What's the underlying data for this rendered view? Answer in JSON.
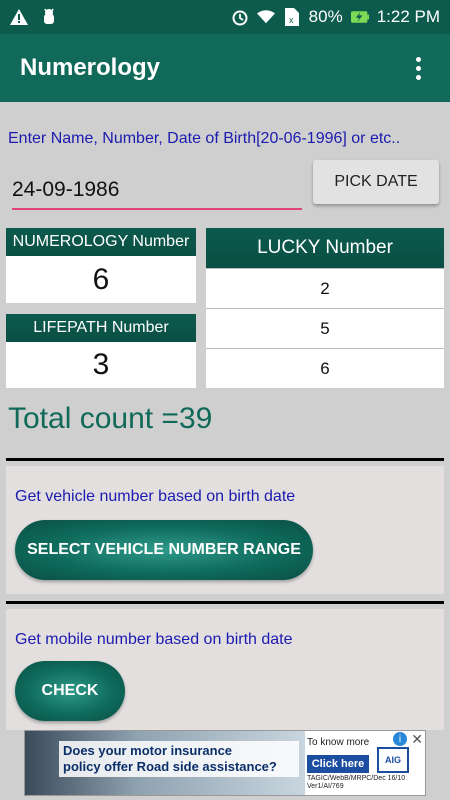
{
  "status_bar": {
    "battery": "80%",
    "time": "1:22 PM",
    "icons": [
      "warning-icon",
      "android-debug-icon",
      "alarm-icon",
      "wifi-icon",
      "sim-no-data-icon",
      "battery-charging-icon"
    ]
  },
  "app_bar": {
    "title": "Numerology",
    "menu_icon": "overflow-menu-icon"
  },
  "input": {
    "hint_label": "Enter Name, Number, Date of Birth[20-06-1996] or etc..",
    "value": "24-09-1986",
    "pick_date_label": "PICK DATE"
  },
  "numerology": {
    "label": "NUMEROLOGY Number",
    "value": "6"
  },
  "lifepath": {
    "label": "LIFEPATH Number",
    "value": "3"
  },
  "lucky": {
    "label": "LUCKY Number",
    "values": [
      "2",
      "5",
      "6"
    ]
  },
  "total": "Total count =39",
  "vehicle": {
    "text": "Get vehicle number based on birth date",
    "button_label": "SELECT VEHICLE NUMBER RANGE"
  },
  "mobile": {
    "text": "Get mobile number based on birth date",
    "button_label": "CHECK"
  },
  "ad": {
    "copy_line1": "Does your motor insurance",
    "copy_line2": "policy offer Road side assistance?",
    "to_know_more": "To know more",
    "click_here": "Click here",
    "brand": "AIG",
    "fine_print": "TAGIC/WebB/MRPC/Dec 16/10 Ver1/AI/769"
  },
  "colors": {
    "primary": "#11695a",
    "primary_dark": "#0d5b4d",
    "hint_text": "#1b1bb0",
    "input_underline": "#e0447a"
  }
}
